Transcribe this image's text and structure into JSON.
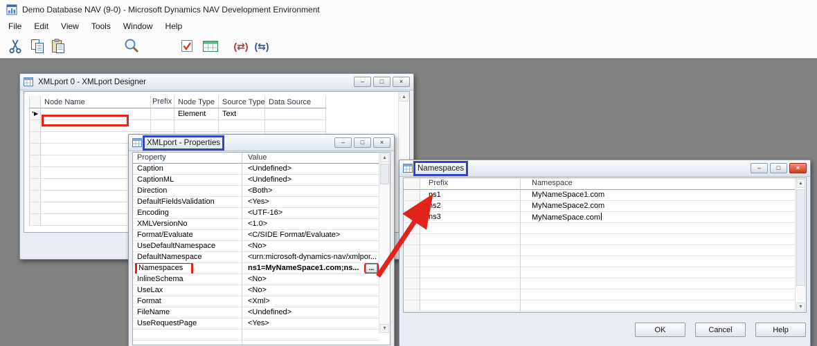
{
  "app": {
    "title": "Demo Database NAV (9-0) - Microsoft Dynamics NAV Development Environment",
    "menu": [
      "File",
      "Edit",
      "View",
      "Tools",
      "Window",
      "Help"
    ]
  },
  "window_controls": {
    "minimize": "–",
    "maximize": "□",
    "close": "×"
  },
  "icons": {
    "row_current": "▶",
    "row_edit": "*▶",
    "scroll_up": "▲",
    "scroll_down": "▼",
    "cside_symbols_red": "(⇄)",
    "cside_symbols_blue": "(⇆)"
  },
  "colors": {
    "annotation_red": "#e2231a",
    "annotation_blue": "#3442c8",
    "desktop_gray": "#828282"
  },
  "designer": {
    "title": "XMLport 0 - XMLport Designer",
    "columns": [
      "Node Name",
      "Prefix",
      "Node Type",
      "Source Type",
      "Data Source"
    ],
    "first_row": {
      "node_type": "Element",
      "source_type": "Text"
    }
  },
  "properties": {
    "title": "XMLport - Properties",
    "columns": [
      "Property",
      "Value"
    ],
    "assist_button": "...",
    "rows": [
      {
        "name": "Caption",
        "value": "<Undefined>"
      },
      {
        "name": "CaptionML",
        "value": "<Undefined>"
      },
      {
        "name": "Direction",
        "value": "<Both>"
      },
      {
        "name": "DefaultFieldsValidation",
        "value": "<Yes>"
      },
      {
        "name": "Encoding",
        "value": "<UTF-16>"
      },
      {
        "name": "XMLVersionNo",
        "value": "<1.0>"
      },
      {
        "name": "Format/Evaluate",
        "value": "<C/SIDE Format/Evaluate>"
      },
      {
        "name": "UseDefaultNamespace",
        "value": "<No>"
      },
      {
        "name": "DefaultNamespace",
        "value": "<urn:microsoft-dynamics-nav/xmlpor..."
      },
      {
        "name": "Namespaces",
        "value": "ns1=MyNameSpace1.com;ns..."
      },
      {
        "name": "InlineSchema",
        "value": "<No>"
      },
      {
        "name": "UseLax",
        "value": "<No>"
      },
      {
        "name": "Format",
        "value": "<Xml>"
      },
      {
        "name": "FileName",
        "value": "<Undefined>"
      },
      {
        "name": "UseRequestPage",
        "value": "<Yes>"
      }
    ]
  },
  "namespaces": {
    "title": "Namespaces",
    "columns": [
      "Prefix",
      "Namespace"
    ],
    "rows": [
      {
        "prefix": "ns1",
        "namespace": "MyNameSpace1.com"
      },
      {
        "prefix": "ns2",
        "namespace": "MyNameSpace2.com"
      },
      {
        "prefix": "ns3",
        "namespace": "MyNameSpace.com"
      }
    ],
    "buttons": {
      "ok": "OK",
      "cancel": "Cancel",
      "help": "Help"
    }
  }
}
